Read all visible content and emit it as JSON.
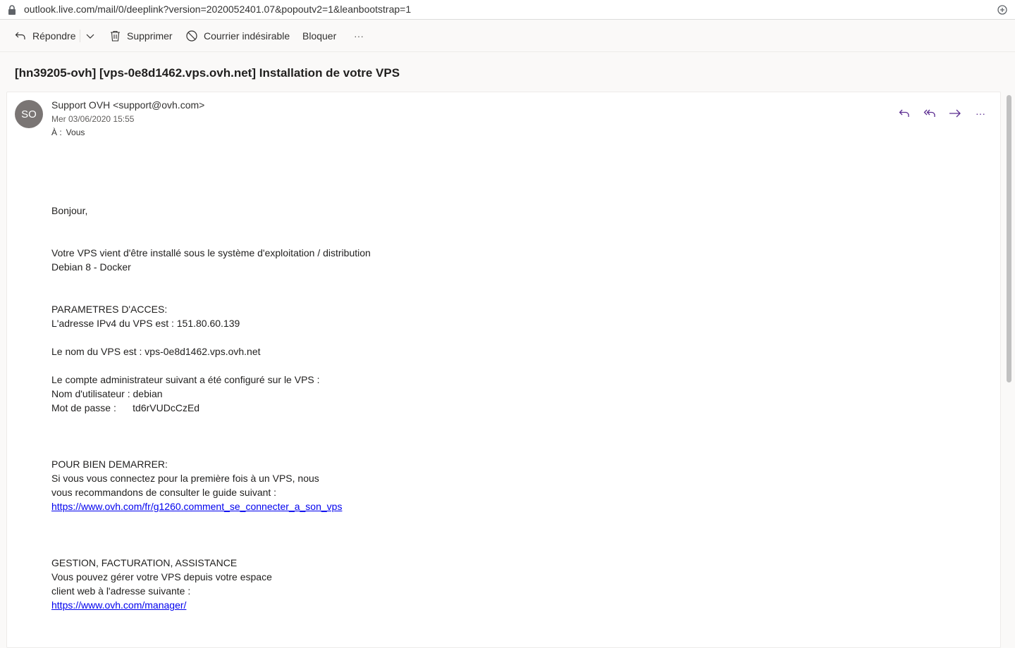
{
  "browser": {
    "url": "outlook.live.com/mail/0/deeplink?version=2020052401.07&popoutv2=1&leanbootstrap=1"
  },
  "toolbar": {
    "reply_label": "Répondre",
    "delete_label": "Supprimer",
    "junk_label": "Courrier indésirable",
    "block_label": "Bloquer",
    "more_label": "···"
  },
  "message": {
    "subject": "[hn39205-ovh] [vps-0e8d1462.vps.ovh.net] Installation de votre VPS",
    "avatar_initials": "SO",
    "avatar_color": "#7a7574",
    "sender": "Support OVH <support@ovh.com>",
    "date": "Mer 03/06/2020 15:55",
    "to_label": "À :",
    "to_value": "Vous",
    "actions_more": "···"
  },
  "body": {
    "greeting": "Bonjour,",
    "install_line1": "Votre VPS vient d'être installé sous le système d'exploitation / distribution",
    "install_line2": "Debian 8 - Docker",
    "access_heading": "PARAMETRES D'ACCES:",
    "ipv4_line": "L'adresse IPv4 du VPS est : 151.80.60.139",
    "name_line": "Le nom du VPS est : vps-0e8d1462.vps.ovh.net",
    "admin_line": "Le compte administrateur suivant a été configuré sur le VPS :",
    "user_line": "Nom d'utilisateur : debian",
    "password_line": "Mot de passe :      td6rVUDcCzEd",
    "start_heading": "POUR BIEN DEMARRER:",
    "start_line1": "Si vous vous connectez pour la première fois à un VPS, nous",
    "start_line2": "vous recommandons de consulter le guide suivant :",
    "guide_link": "https://www.ovh.com/fr/g1260.comment_se_connecter_a_son_vps",
    "manage_heading": "GESTION, FACTURATION, ASSISTANCE",
    "manage_line1": "Vous pouvez gérer votre VPS depuis votre espace",
    "manage_line2": "client web à l'adresse suivante :",
    "manager_link": "https://www.ovh.com/manager/"
  },
  "colors": {
    "accent": "#5c2d91",
    "link": "#0000ee"
  }
}
